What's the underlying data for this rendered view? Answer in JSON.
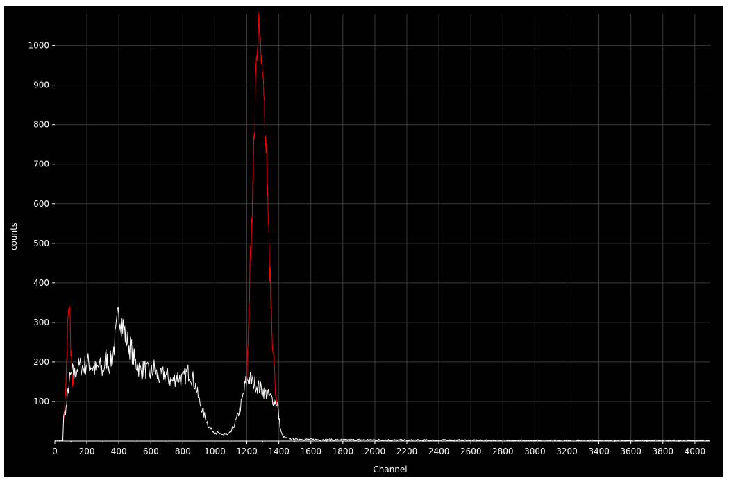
{
  "chart_data": {
    "type": "line",
    "title": "",
    "xlabel": "Channel",
    "ylabel": "counts",
    "xlim": [
      0,
      4096
    ],
    "ylim": [
      0,
      1080
    ],
    "grid": true,
    "x_ticks": [
      0,
      200,
      400,
      600,
      800,
      1000,
      1200,
      1400,
      1600,
      1800,
      2000,
      2200,
      2400,
      2600,
      2800,
      3000,
      3200,
      3400,
      3600,
      3800,
      4000
    ],
    "y_ticks": [
      100,
      200,
      300,
      400,
      500,
      600,
      700,
      800,
      900,
      1000
    ],
    "colors": {
      "background": "#000000",
      "grid": "#3a3a3a",
      "spectrum": "#ffffff",
      "roi": "#ff0000",
      "text": "#ffffff"
    },
    "series": [
      {
        "color": "#ffffff",
        "x": [
          0,
          50,
          55,
          60,
          70,
          90,
          110,
          120,
          140,
          160,
          180,
          200,
          220,
          240,
          260,
          280,
          300,
          320,
          340,
          360,
          380,
          400,
          420,
          440,
          460,
          480,
          500,
          520,
          540,
          560,
          580,
          600,
          620,
          640,
          660,
          680,
          700,
          720,
          740,
          760,
          780,
          800,
          820,
          840,
          860,
          880,
          900,
          920,
          940,
          960,
          980,
          1000,
          1020,
          1040,
          1060,
          1080,
          1100,
          1120,
          1140,
          1160,
          1180,
          1190,
          1200,
          1210,
          1390,
          1400,
          1410,
          1420,
          1440,
          1460,
          1500,
          1600,
          1800,
          2000,
          2200,
          2400,
          2600,
          2800,
          3000,
          3200,
          3400,
          3600,
          3800,
          4000,
          4096
        ],
        "y": [
          0,
          0,
          65,
          70,
          80,
          150,
          175,
          165,
          185,
          190,
          185,
          200,
          195,
          185,
          180,
          190,
          175,
          210,
          190,
          215,
          260,
          330,
          300,
          270,
          245,
          230,
          200,
          190,
          175,
          185,
          175,
          170,
          185,
          165,
          160,
          170,
          165,
          155,
          150,
          165,
          160,
          155,
          170,
          175,
          160,
          140,
          105,
          80,
          60,
          40,
          28,
          22,
          20,
          15,
          18,
          15,
          22,
          40,
          60,
          85,
          120,
          145,
          155,
          160,
          95,
          60,
          30,
          15,
          8,
          6,
          5,
          4,
          3,
          3,
          2,
          2,
          2,
          1,
          1,
          1,
          1,
          1,
          1,
          1,
          1
        ]
      },
      {
        "color": "#ff0000",
        "x": [
          60,
          70,
          80,
          85,
          90,
          95,
          100,
          110,
          120
        ],
        "y": [
          65,
          160,
          270,
          360,
          370,
          300,
          220,
          160,
          140
        ]
      },
      {
        "color": "#ff0000",
        "x": [
          1200,
          1210,
          1220,
          1230,
          1240,
          1250,
          1260,
          1270,
          1275,
          1280,
          1285,
          1290,
          1300,
          1310,
          1320,
          1330,
          1340,
          1350,
          1360,
          1370,
          1380,
          1390
        ],
        "y": [
          155,
          270,
          420,
          560,
          700,
          820,
          940,
          1000,
          1060,
          980,
          1040,
          930,
          900,
          820,
          740,
          620,
          500,
          380,
          270,
          190,
          130,
          95
        ]
      }
    ]
  }
}
